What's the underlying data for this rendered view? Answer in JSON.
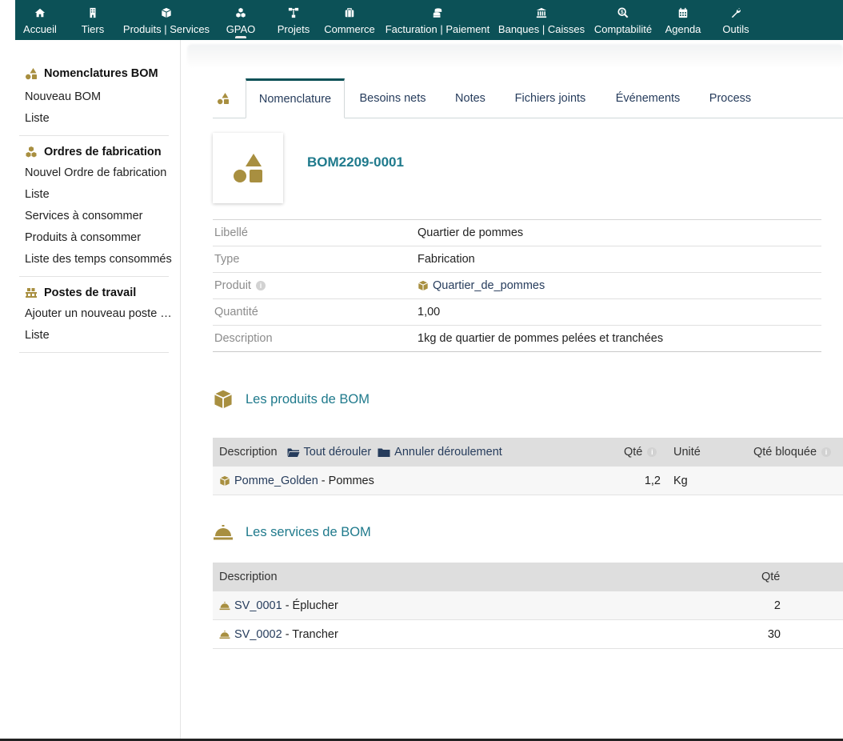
{
  "colors": {
    "topbar": "#0c5157",
    "accent_title": "#1f7a8c",
    "link": "#263c5c",
    "icon_gold": "#a88f40"
  },
  "topnav": [
    {
      "label": "Accueil",
      "icon": "home-icon"
    },
    {
      "label": "Tiers",
      "icon": "building-icon"
    },
    {
      "label": "Produits | Services",
      "icon": "cube-icon"
    },
    {
      "label": "GPAO",
      "icon": "cubes-icon"
    },
    {
      "label": "Projets",
      "icon": "sitemap-icon"
    },
    {
      "label": "Commerce",
      "icon": "suitcase-icon"
    },
    {
      "label": "Facturation | Paiement",
      "icon": "coins-icon"
    },
    {
      "label": "Banques | Caisses",
      "icon": "bank-icon"
    },
    {
      "label": "Comptabilité",
      "icon": "search-dollar-icon"
    },
    {
      "label": "Agenda",
      "icon": "calendar-icon"
    },
    {
      "label": "Outils",
      "icon": "wrench-icon"
    }
  ],
  "sidebar": {
    "sections": [
      {
        "title": "Nomenclatures BOM",
        "icon": "shapes-icon",
        "links": [
          "Nouveau BOM",
          "Liste"
        ]
      },
      {
        "title": "Ordres de fabrication",
        "icon": "cubes-icon",
        "links": [
          "Nouvel Ordre de fabrication",
          "Liste",
          "Services à consommer",
          "Produits à consommer",
          "Liste des temps consommés"
        ]
      },
      {
        "title": "Postes de travail",
        "icon": "pallet-icon",
        "links": [
          "Ajouter un nouveau poste de travail",
          "Liste"
        ]
      }
    ]
  },
  "tabs": [
    "Nomenclature",
    "Besoins nets",
    "Notes",
    "Fichiers joints",
    "Événements",
    "Process"
  ],
  "ref": "BOM2209-0001",
  "fields": [
    {
      "label": "Libellé",
      "value": "Quartier de pommes"
    },
    {
      "label": "Type",
      "value": "Fabrication"
    },
    {
      "label": "Produit",
      "value": "Quartier_de_pommes"
    },
    {
      "label": "Quantité",
      "value": "1,00"
    },
    {
      "label": "Description",
      "value": "1kg de quartier de pommes pelées et tranchées"
    }
  ],
  "products_section": {
    "title": "Les produits de BOM",
    "headers": {
      "description": "Description",
      "expand": "Tout dérouler",
      "collapse": "Annuler déroulement",
      "qty": "Qté",
      "unit": "Unité",
      "qty_frozen": "Qté bloquée"
    },
    "rows": [
      {
        "ref": "Pomme_Golden",
        "label": " - Pommes",
        "qty": "1,2",
        "unit": "Kg"
      }
    ]
  },
  "services_section": {
    "title": "Les services de BOM",
    "headers": {
      "description": "Description",
      "qty": "Qté"
    },
    "rows": [
      {
        "ref": "SV_0001",
        "label": " - Éplucher",
        "qty": "2"
      },
      {
        "ref": "SV_0002",
        "label": " - Trancher",
        "qty": "30"
      }
    ]
  }
}
